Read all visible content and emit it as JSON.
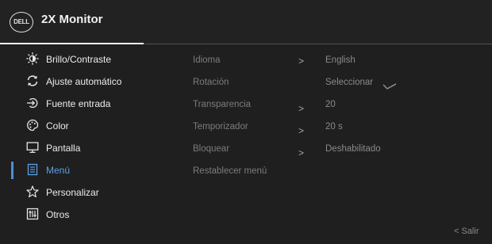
{
  "header": {
    "logo_text": "DELL",
    "title": "2X Monitor"
  },
  "sidebar": {
    "items": [
      {
        "label": "Brillo/Contraste",
        "icon": "brightness-icon",
        "active": false
      },
      {
        "label": "Ajuste automático",
        "icon": "auto-adjust-icon",
        "active": false
      },
      {
        "label": "Fuente entrada",
        "icon": "input-source-icon",
        "active": false
      },
      {
        "label": "Color",
        "icon": "palette-icon",
        "active": false
      },
      {
        "label": "Pantalla",
        "icon": "display-icon",
        "active": false
      },
      {
        "label": "Menú",
        "icon": "menu-icon",
        "active": true
      },
      {
        "label": "Personalizar",
        "icon": "star-icon",
        "active": false
      },
      {
        "label": "Otros",
        "icon": "others-icon",
        "active": false
      }
    ]
  },
  "menu_settings": {
    "rows": [
      {
        "name": "Idioma",
        "chevron": ">",
        "value": "English"
      },
      {
        "name": "Rotación",
        "chevron": "",
        "value": "Seleccionar"
      },
      {
        "name": "Transparencia",
        "chevron": ">",
        "value": "20"
      },
      {
        "name": "Temporizador",
        "chevron": ">",
        "value": "20 s"
      },
      {
        "name": "Bloquear",
        "chevron": ">",
        "value": "Deshabilitado"
      },
      {
        "name": "Restablecer menú",
        "chevron": "",
        "value": ""
      }
    ]
  },
  "footer": {
    "exit_label": "< Salir"
  },
  "colors": {
    "accent": "#4a8fdc",
    "background": "#1f1f1f",
    "text": "#ececec",
    "dim_text": "#7c7c7c"
  }
}
